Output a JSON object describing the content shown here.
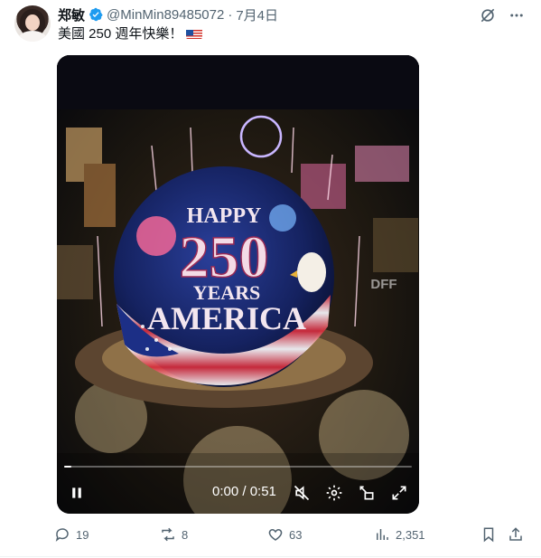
{
  "post": {
    "author_name": "郑敏",
    "handle": "@MinMin89485072",
    "separator": "·",
    "date": "7月4日",
    "text": "美國 250 週年快樂！",
    "flag_icon": "us-flag-emoji"
  },
  "video": {
    "overlay_lines": [
      "HAPPY",
      "250",
      "YEARS",
      "AMERICA"
    ],
    "watermark": "DFF",
    "time": "0:00 / 0:51",
    "progress": 0.02
  },
  "actions": {
    "replies": "19",
    "reposts": "8",
    "likes": "63",
    "views": "2,351"
  },
  "colors": {
    "accent": "#1d9bf0",
    "muted": "#536471"
  }
}
